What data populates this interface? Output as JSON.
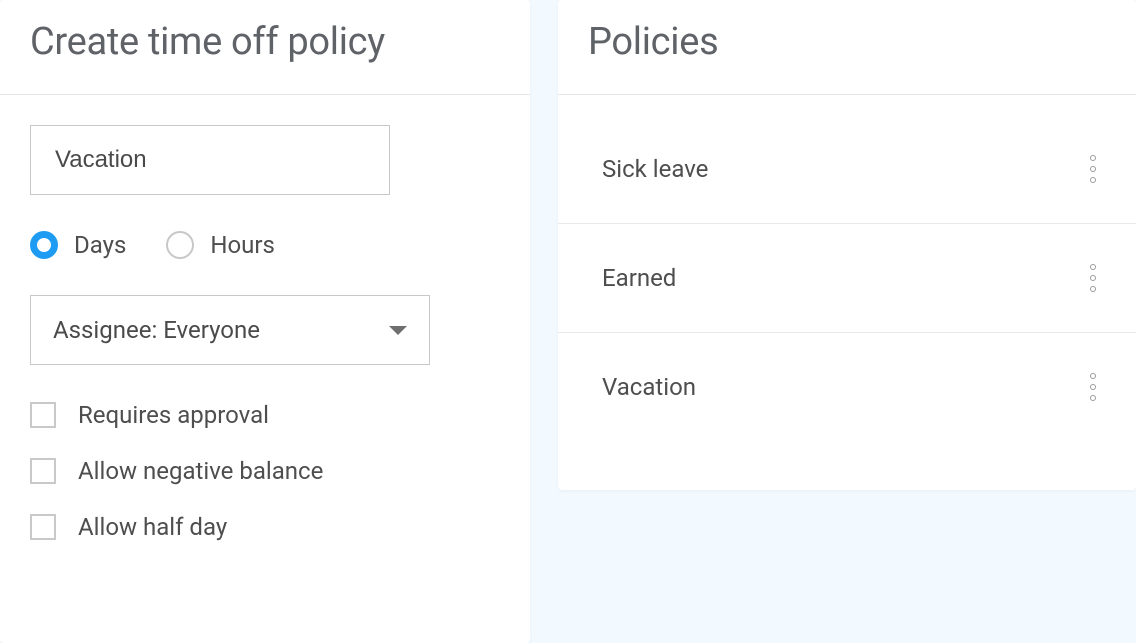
{
  "form": {
    "title": "Create time off policy",
    "name_value": "Vacation",
    "unit_options": {
      "days": {
        "label": "Days",
        "selected": true
      },
      "hours": {
        "label": "Hours",
        "selected": false
      }
    },
    "assignee": {
      "label": "Assignee: Everyone"
    },
    "checkboxes": {
      "requires_approval": {
        "label": "Requires approval",
        "checked": false
      },
      "allow_negative": {
        "label": "Allow negative balance",
        "checked": false
      },
      "allow_half_day": {
        "label": "Allow half day",
        "checked": false
      }
    }
  },
  "policies_panel": {
    "title": "Policies",
    "items": [
      {
        "name": "Sick leave"
      },
      {
        "name": "Earned"
      },
      {
        "name": "Vacation"
      }
    ]
  }
}
